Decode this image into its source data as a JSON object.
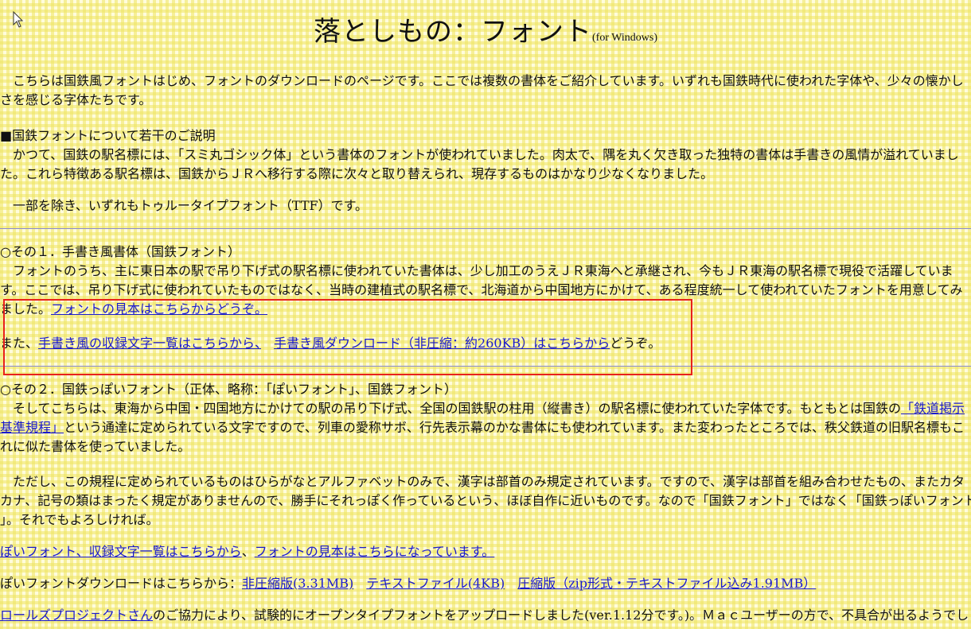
{
  "header": {
    "title": "落としもの：フォント",
    "subtitle": "(for Windows)"
  },
  "intro": {
    "line1": "　こちらは国鉄風フォントはじめ、フォントのダウンロードのページです。ここでは複数の書体をご紹介しています。いずれも国鉄時代に使われた字体や、少々の懐かし",
    "line2": "さを感じる字体たちです。"
  },
  "about": {
    "heading": "■国鉄フォントについて若干のご説明",
    "line1": "　かつて、国鉄の駅名標には、「スミ丸ゴシック体」という書体のフォントが使われていました。肉太で、隅を丸く欠き取った独特の書体は手書きの風情が溢れていまし",
    "line2": "た。これら特徴ある駅名標は、国鉄からＪＲへ移行する際に次々と取り替えられ、現存するものはかなり少なくなりました。",
    "ttf_note": "　一部を除き、いずれもトゥルータイプフォント（TTF）です。"
  },
  "section1": {
    "heading": "○その１．手書き風書体（国鉄フォント）",
    "line1": "　フォントのうち、主に東日本の駅で吊り下げ式の駅名標に使われていた書体は、少し加工のうえＪＲ東海へと承継され、今もＪＲ東海の駅名標で現役で活躍していま",
    "line2": "す。ここでは、吊り下げ式に使われていたものではなく、当時の建植式の駅名標で、北海道から中国地方にかけて、ある程度統一して使われていたフォントを用意してみ",
    "line3_prefix": "ました。",
    "sample_link": "フォントの見本はこちらからどうぞ。",
    "dl_prefix": "また、",
    "charlist_link": "手書き風の収録文字一覧はこちらから、",
    "dl_gap": "　",
    "download_link": "手書き風ダウンロード（非圧縮：約260KB）はこちらから",
    "dl_suffix": "どうぞ。"
  },
  "section2": {
    "heading": "○その２．国鉄っぽいフォント（正体、略称：「ぽいフォント」、国鉄フォント）",
    "p1_line1_prefix": "　そしてこちらは、東海から中国・四国地方にかけての駅の吊り下げ式、全国の国鉄駅の柱用（縦書き）の駅名標に使われていた字体です。もともとは国鉄の",
    "p1_link_part1": "「鉄道掲示",
    "p1_link_part2": "基準規程」",
    "p1_line2_suffix": "という通達に定められている文字ですので、列車の愛称サボ、行先表示幕のかな書体にも使われています。また変わったところでは、秩父鉄道の旧駅名標もこ",
    "p1_line3": "れに似た書体を使っていました。",
    "p2_line1": "　ただし、この規程に定められているものはひらがなとアルファベットのみで、漢字は部首のみ規定されています。ですので、漢字は部首を組み合わせたもの、またカタ",
    "p2_line2": "カナ、記号の類はまったく規定がありませんので、勝手にそれっぽく作っているという、ほぼ自作に近いものです。なので「国鉄フォント」ではなく「国鉄っぽいフォント",
    "p2_line3": "」。それでもよろしければ。",
    "charlist_link": "ぽいフォント、収録文字一覧はこちらから",
    "links_sep": "、",
    "sample_link": "フォントの見本はこちらになっています。",
    "download_prefix": "ぽいフォントダウンロードはこちらから：",
    "dl_uncompressed": "非圧縮版(3.31MB)",
    "dl_text": "テキストファイル(4KB)",
    "dl_zip": "圧縮版（zip形式・テキストファイル込み1.91MB）",
    "last_link": "ロールズプロジェクトさん",
    "last_suffix": "のご協力により、試験的にオープンタイプフォントをアップロードしました(ver.1.12分です。)。Ｍａｃユーザーの方で、不具合が出るようでし"
  },
  "colors": {
    "link": "#1a1acc",
    "highlight_box": "#e8221c",
    "background_check": "#eee460"
  }
}
